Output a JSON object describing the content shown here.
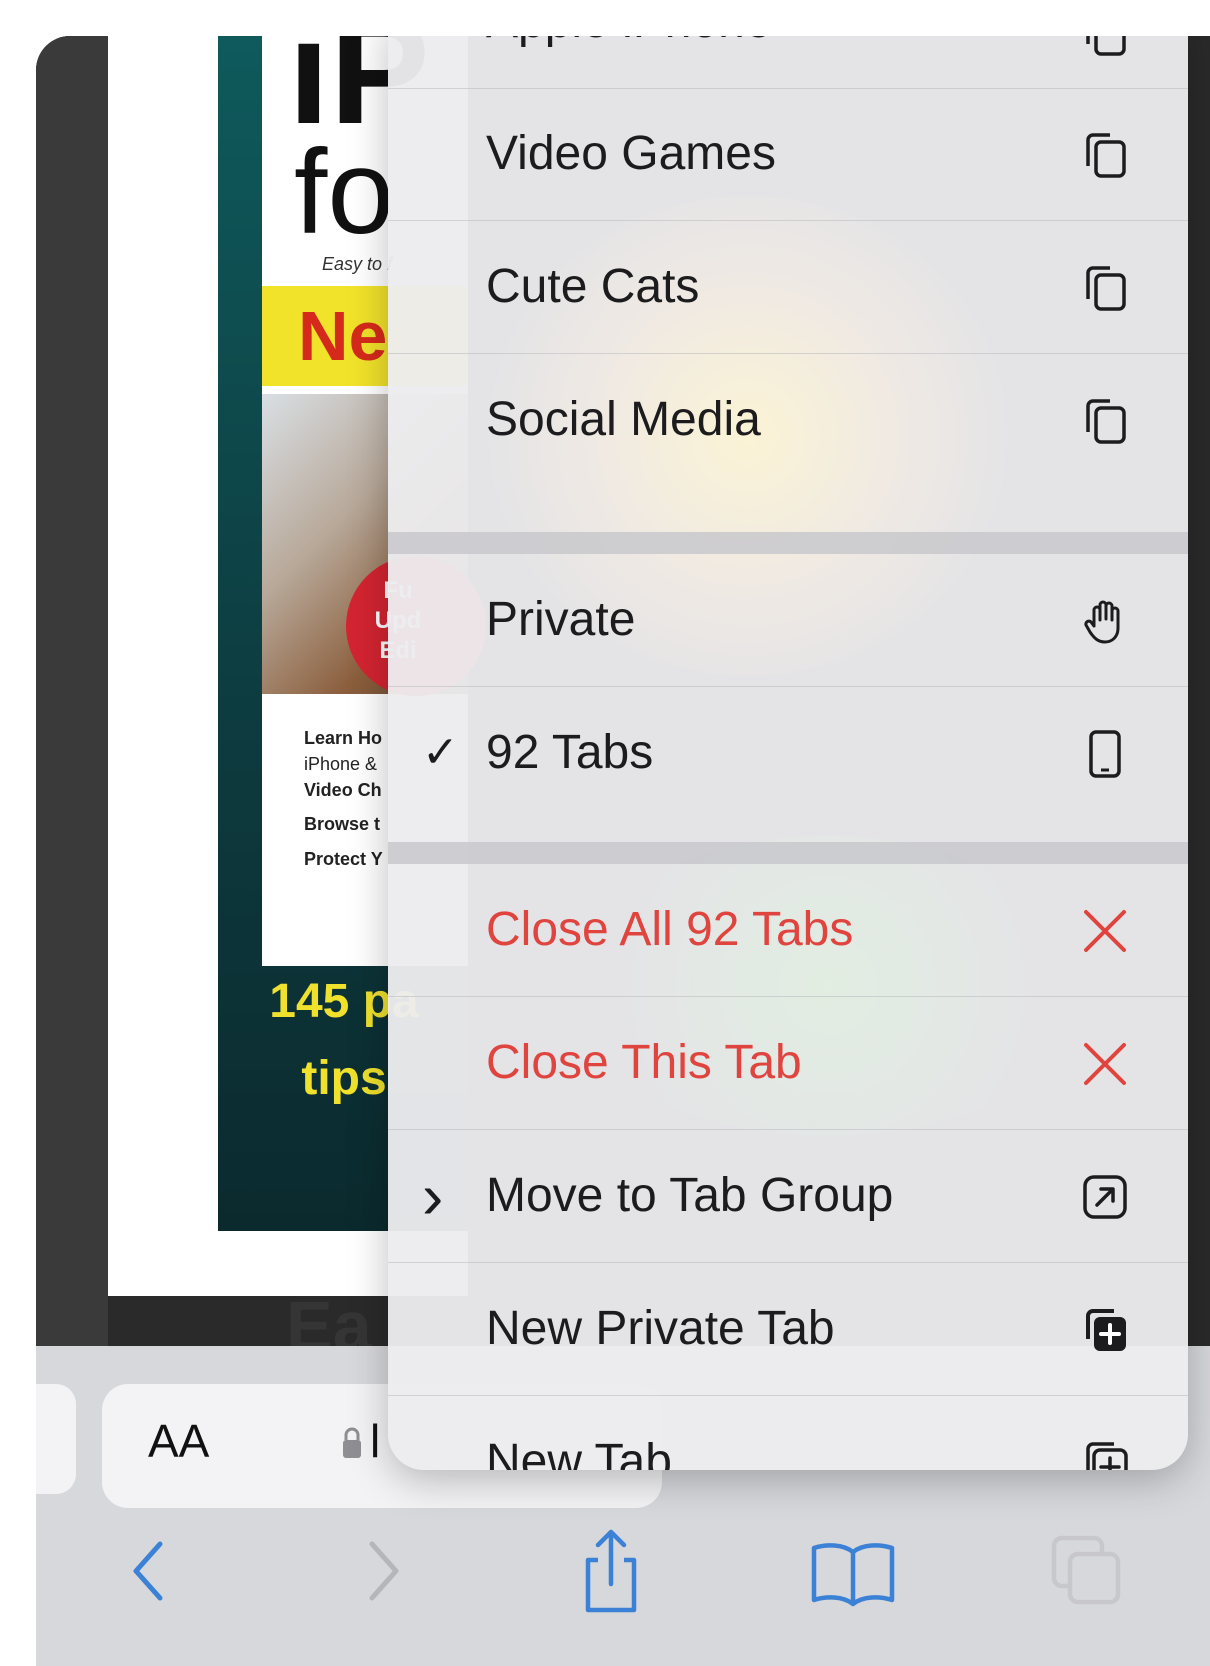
{
  "cover": {
    "title_line1": "iP",
    "title_line2": "fo",
    "tagline": "Easy to f",
    "banner": "Ne",
    "badge_lines": [
      "Fu",
      "Upd",
      "Edi"
    ],
    "list": [
      "Learn Ho",
      "iPhone &",
      "Video Ch",
      "Browse t",
      "Protect Y"
    ],
    "promo_line1": "145 pa",
    "promo_line2": "tips",
    "faded_text": "Ea"
  },
  "address_bar": {
    "text_size_label": "AA",
    "url_fragment": "l"
  },
  "menu": {
    "partial_top_item": "Apple iPhone",
    "group_items": [
      {
        "label": "Video Games",
        "icon": "tab-group-icon"
      },
      {
        "label": "Cute Cats",
        "icon": "tab-group-icon"
      },
      {
        "label": "Social Media",
        "icon": "tab-group-icon"
      }
    ],
    "mode_items": [
      {
        "label": "Private",
        "icon": "hand-icon",
        "checked": false
      },
      {
        "label": "92 Tabs",
        "icon": "phone-icon",
        "checked": true
      }
    ],
    "checkmark": "✓",
    "chevron": "›",
    "close_all": "Close All 92 Tabs",
    "close_this": "Close This Tab",
    "move_to_group": "Move to Tab Group",
    "new_private_tab": "New Private Tab",
    "new_tab": "New Tab",
    "destructive_color": "#e0443f"
  },
  "toolbar": {
    "icons": [
      "back-icon",
      "forward-icon",
      "share-icon",
      "bookmarks-icon",
      "tabs-icon"
    ]
  }
}
